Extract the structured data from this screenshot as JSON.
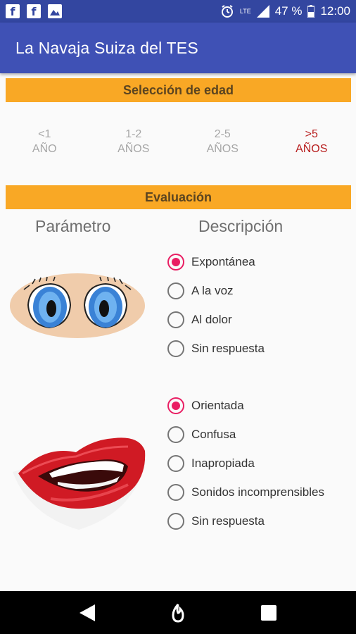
{
  "status_bar": {
    "network": "LTE",
    "battery": "47 %",
    "time": "12:00"
  },
  "app_bar": {
    "title": "La Navaja Suiza del TES"
  },
  "age_section": {
    "header": "Selección de edad",
    "options": [
      {
        "line1": "<1",
        "line2": "AÑO",
        "selected": false
      },
      {
        "line1": "1-2",
        "line2": "AÑOS",
        "selected": false
      },
      {
        "line1": "2-5",
        "line2": "AÑOS",
        "selected": false
      },
      {
        "line1": ">5",
        "line2": "AÑOS",
        "selected": true
      }
    ]
  },
  "evaluation": {
    "header": "Evaluación",
    "col_param": "Parámetro",
    "col_desc": "Descripción",
    "eyes_options": [
      {
        "label": "Expontánea",
        "checked": true
      },
      {
        "label": "A la voz",
        "checked": false
      },
      {
        "label": "Al dolor",
        "checked": false
      },
      {
        "label": "Sin respuesta",
        "checked": false
      }
    ],
    "verbal_options": [
      {
        "label": "Orientada",
        "checked": true
      },
      {
        "label": "Confusa",
        "checked": false
      },
      {
        "label": "Inapropiada",
        "checked": false
      },
      {
        "label": "Sonidos incomprensibles",
        "checked": false
      },
      {
        "label": "Sin respuesta",
        "checked": false
      }
    ]
  },
  "colors": {
    "primary": "#3f51b5",
    "primary_dark": "#3346a0",
    "section": "#f9a825",
    "accent": "#e91e63",
    "selected_age": "#b71c1c"
  }
}
